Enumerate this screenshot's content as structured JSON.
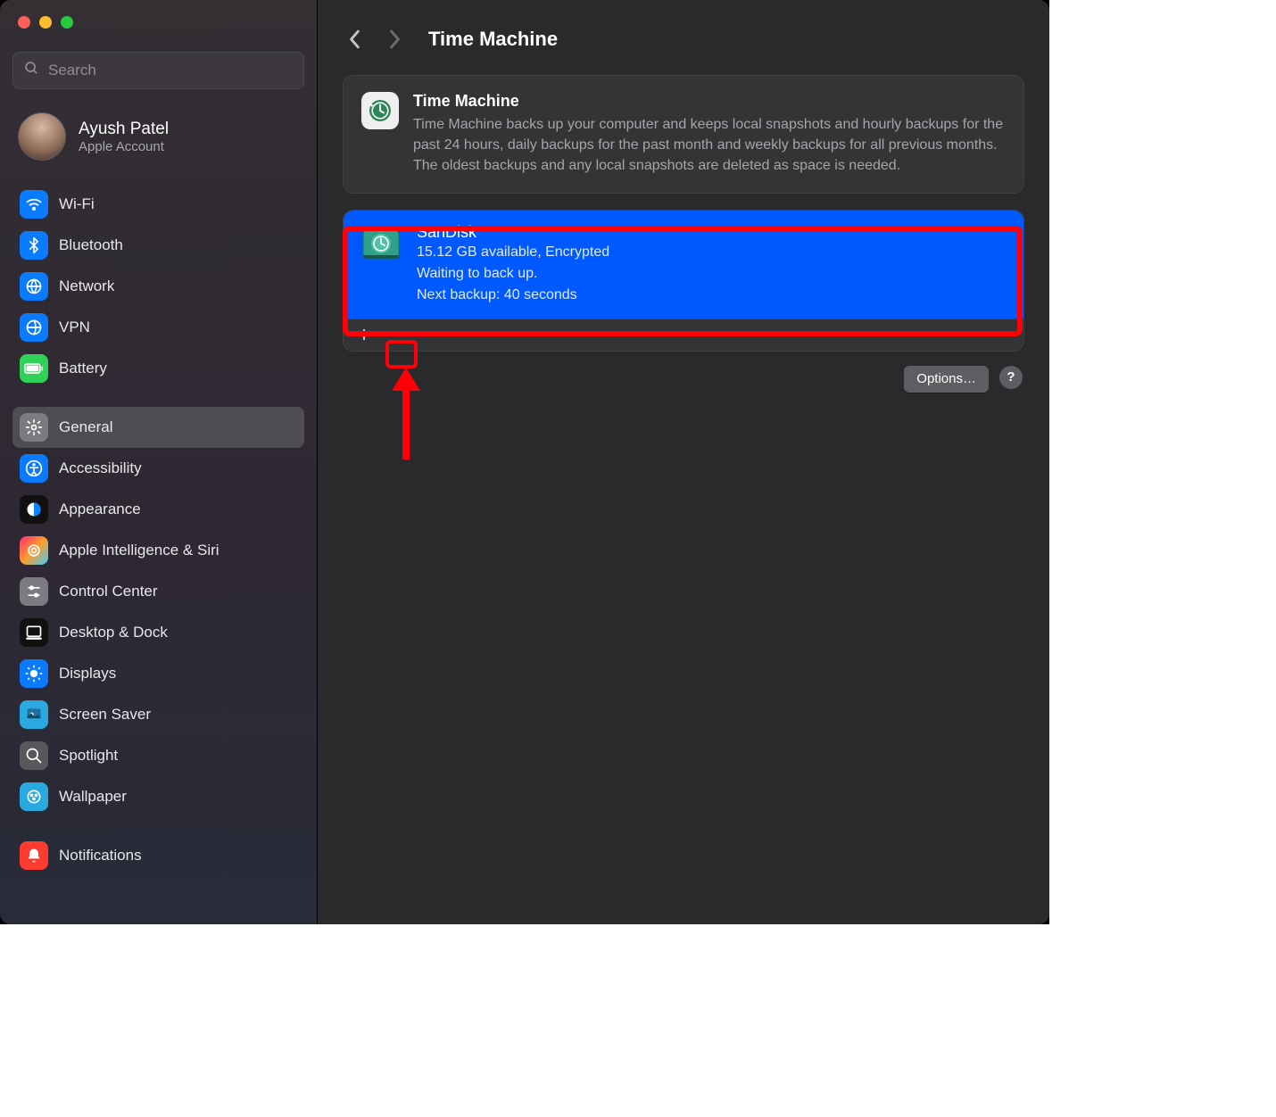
{
  "window": {
    "search_placeholder": "Search",
    "account": {
      "name": "Ayush Patel",
      "subtitle": "Apple Account"
    },
    "sidebar_groups": [
      [
        {
          "key": "wifi",
          "label": "Wi-Fi",
          "color": "#0a7aff",
          "glyph": "wifi"
        },
        {
          "key": "bluetooth",
          "label": "Bluetooth",
          "color": "#0a7aff",
          "glyph": "bt"
        },
        {
          "key": "network",
          "label": "Network",
          "color": "#0a7aff",
          "glyph": "globe"
        },
        {
          "key": "vpn",
          "label": "VPN",
          "color": "#0a7aff",
          "glyph": "vpn"
        },
        {
          "key": "battery",
          "label": "Battery",
          "color": "#30d158",
          "glyph": "batt"
        }
      ],
      [
        {
          "key": "general",
          "label": "General",
          "color": "#7c7c80",
          "glyph": "gear",
          "selected": true
        },
        {
          "key": "accessibility",
          "label": "Accessibility",
          "color": "#0a7aff",
          "glyph": "acc"
        },
        {
          "key": "appearance",
          "label": "Appearance",
          "color": "#111",
          "glyph": "appear"
        },
        {
          "key": "ai",
          "label": "Apple Intelligence & Siri",
          "color": "linear-gradient(135deg,#ff2d73,#ff9d2b,#3ecbff)",
          "glyph": "ai"
        },
        {
          "key": "cc",
          "label": "Control Center",
          "color": "#7c7c80",
          "glyph": "cc"
        },
        {
          "key": "dock",
          "label": "Desktop & Dock",
          "color": "#111",
          "glyph": "dock"
        },
        {
          "key": "displays",
          "label": "Displays",
          "color": "#0a7aff",
          "glyph": "disp"
        },
        {
          "key": "screensaver",
          "label": "Screen Saver",
          "color": "#2aa9e0",
          "glyph": "ss"
        },
        {
          "key": "spotlight",
          "label": "Spotlight",
          "color": "#58585c",
          "glyph": "spot"
        },
        {
          "key": "wallpaper",
          "label": "Wallpaper",
          "color": "#2aa9e0",
          "glyph": "wall"
        }
      ],
      [
        {
          "key": "notifications",
          "label": "Notifications",
          "color": "#ff3b30",
          "glyph": "notif"
        }
      ]
    ]
  },
  "content": {
    "title": "Time Machine",
    "info": {
      "title": "Time Machine",
      "description": "Time Machine backs up your computer and keeps local snapshots and hourly backups for the past 24 hours, daily backups for the past month and weekly backups for all previous months. The oldest backups and any local snapshots are deleted as space is needed."
    },
    "disk": {
      "name": "SanDisk",
      "available_line": "15.12 GB available, Encrypted",
      "status_line": "Waiting to back up.",
      "next_line": "Next backup: 40 seconds"
    },
    "options_label": "Options…",
    "help_label": "?"
  }
}
